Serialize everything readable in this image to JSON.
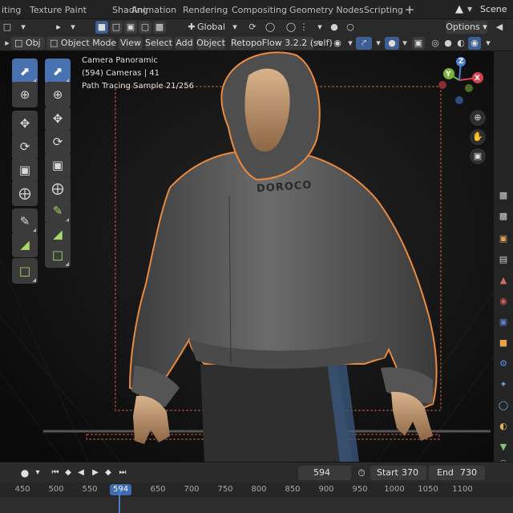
{
  "workspace_tabs": [
    "iting",
    "Texture Paint",
    "Shading",
    "Animation",
    "Rendering",
    "Compositing",
    "Geometry Nodes",
    "Scripting"
  ],
  "add_tab": "+",
  "scene": {
    "label": "Scene",
    "icon": "scene-icon"
  },
  "header1": {
    "transform_orientation": "Global",
    "options_label": "Options"
  },
  "header2": {
    "object_label": "Obj",
    "mode": "Object Mode",
    "menus": [
      "View",
      "Select",
      "Add",
      "Object"
    ],
    "addon": "RetopoFlow 3.2.2 (self)"
  },
  "viewport": {
    "camera_name": "Camera Panoramic",
    "collection_info": "(594) Cameras | 41",
    "render_status": "Path Tracing Sample 21/256",
    "hoodie_print": "DOROCO",
    "gizmo_axes": {
      "x": "X",
      "y": "Y",
      "z": "Z"
    },
    "colors": {
      "axis_x": "#d8424f",
      "axis_y": "#7ab33b",
      "axis_z": "#4a7fd1",
      "outline": "#e98a3c",
      "background": "#0e0e0e"
    }
  },
  "toolbar": {
    "col1": [
      "select-box-icon",
      "cursor-icon",
      "move-icon",
      "rotate-icon",
      "scale-icon",
      "transform-icon",
      "annotate-icon",
      "measure-icon",
      "add-cube-icon"
    ],
    "col2": [
      "select-box-icon",
      "cursor-icon",
      "move-icon",
      "rotate-icon",
      "scale-icon",
      "transform-icon",
      "annotate-line-icon",
      "measure-icon",
      "add-cube-icon"
    ]
  },
  "timeline": {
    "current_frame": "594",
    "start_label": "Start",
    "start_value": "370",
    "end_label": "End",
    "end_value": "730",
    "ruler_ticks": [
      "450",
      "500",
      "550",
      "650",
      "700",
      "750",
      "800",
      "850",
      "900",
      "950",
      "1000",
      "1050",
      "1100"
    ],
    "ruler_current": "594"
  }
}
